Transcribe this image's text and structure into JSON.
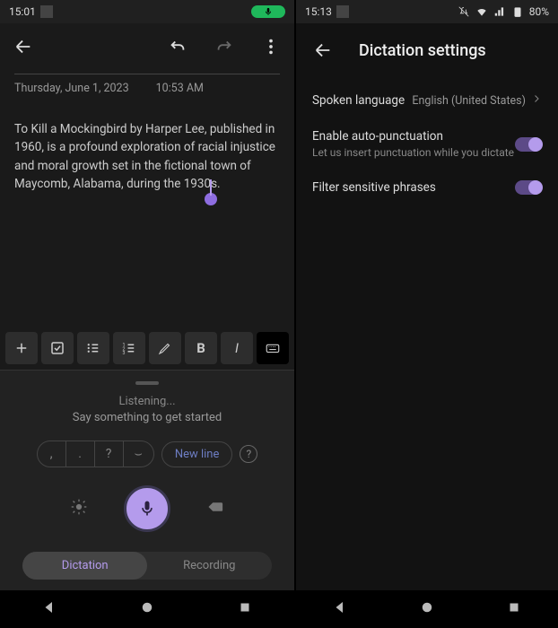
{
  "left_screen": {
    "status": {
      "time": "15:01"
    },
    "note": {
      "date": "Thursday, June 1, 2023",
      "time": "10:53 AM",
      "body": "To Kill a Mockingbird by Harper Lee, published in 1960, is a profound exploration of racial injustice and moral growth set in the fictional town of Maycomb, Alabama, during the 1930s."
    },
    "toolbar": {
      "bold": "B",
      "italic": "I"
    },
    "dictation": {
      "listening_line1": "Listening...",
      "listening_line2": "Say something to get started",
      "comma": ",",
      "period": ".",
      "question": "?",
      "space": "⌣",
      "newline": "New line",
      "mode_dictation": "Dictation",
      "mode_recording": "Recording"
    }
  },
  "right_screen": {
    "status": {
      "time": "15:13",
      "battery": "80%"
    },
    "header": {
      "title": "Dictation settings"
    },
    "settings": {
      "spoken_language": {
        "label": "Spoken language",
        "value": "English (United States)"
      },
      "auto_punct": {
        "label": "Enable auto-punctuation",
        "sub": "Let us insert punctuation while you dictate"
      },
      "filter": {
        "label": "Filter sensitive phrases"
      }
    }
  }
}
